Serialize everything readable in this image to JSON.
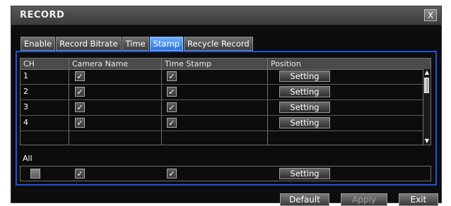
{
  "window": {
    "title": "RECORD",
    "close_glyph": "X"
  },
  "tabs": [
    {
      "label": "Enable",
      "active": false
    },
    {
      "label": "Record Bitrate",
      "active": false
    },
    {
      "label": "Time",
      "active": false
    },
    {
      "label": "Stamp",
      "active": true
    },
    {
      "label": "Recycle Record",
      "active": false
    }
  ],
  "table": {
    "headers": {
      "ch": "CH",
      "camera_name": "Camera Name",
      "time_stamp": "Time Stamp",
      "position": "Position"
    },
    "rows": [
      {
        "ch": "1",
        "camera_name_checked": true,
        "time_stamp_checked": true,
        "position_label": "Setting"
      },
      {
        "ch": "2",
        "camera_name_checked": true,
        "time_stamp_checked": true,
        "position_label": "Setting"
      },
      {
        "ch": "3",
        "camera_name_checked": true,
        "time_stamp_checked": true,
        "position_label": "Setting"
      },
      {
        "ch": "4",
        "camera_name_checked": true,
        "time_stamp_checked": true,
        "position_label": "Setting"
      }
    ]
  },
  "all": {
    "label": "All",
    "select_all_checked": false,
    "camera_name_checked": true,
    "time_stamp_checked": true,
    "position_label": "Setting"
  },
  "footer": {
    "default_label": "Default",
    "apply_label": "Apply",
    "exit_label": "Exit"
  },
  "icons": {
    "checkmark": "✓",
    "scroll_up": "▲",
    "scroll_down": "▼"
  },
  "colors": {
    "active_tab": "#2a6fd9",
    "panel_border": "#1f53d6",
    "background": "#0d0d0d"
  }
}
